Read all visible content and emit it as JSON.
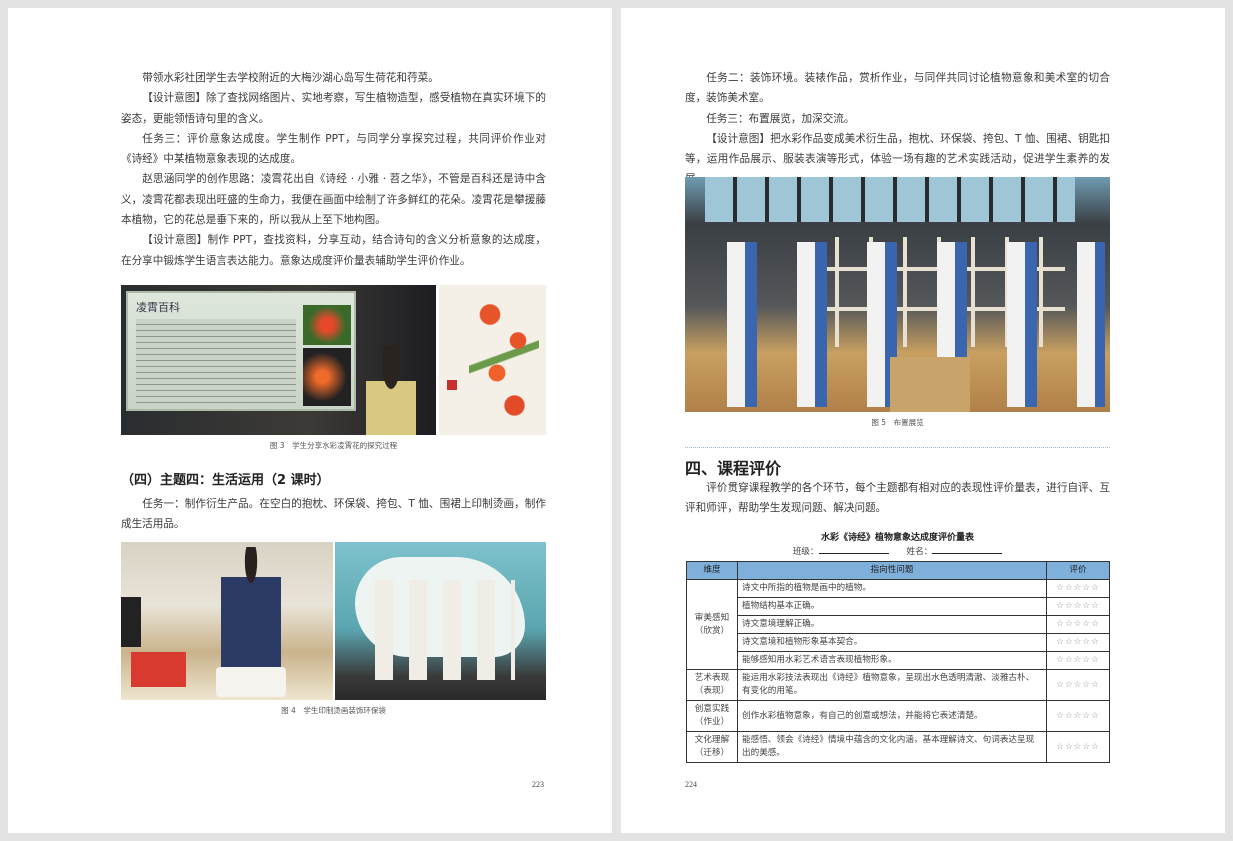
{
  "left_page": {
    "paragraphs": [
      "带领水彩社团学生去学校附近的大梅沙湖心岛写生荷花和荇菜。",
      "【设计意图】除了查找网络图片、实地考察，写生植物造型，感受植物在真实环境下的姿态，更能领悟诗句里的含义。",
      "任务三：评价意象达成度。学生制作 PPT，与同学分享探究过程，共同评价作业对《诗经》中某植物意象表现的达成度。",
      "赵思涵同学的创作思路：凌霄花出自《诗经 · 小雅 · 苕之华》，不管是百科还是诗中含义，凌霄花都表现出旺盛的生命力，我便在画面中绘制了许多鲜红的花朵。凌霄花是攀援藤本植物，它的花总是垂下来的，所以我从上至下地构图。",
      "【设计意图】制作 PPT，查找资料，分享互动，结合诗句的含义分析意象的达成度，在分享中锻炼学生语言表达能力。意象达成度评价量表辅助学生评价作业。"
    ],
    "slide_title": "凌霄百科",
    "figure3_caption": "图 3　学生分享水彩凌霄花的探究过程",
    "section_heading": "（四）主题四：生活运用（2 课时）",
    "task1": "任务一：制作衍生产品。在空白的抱枕、环保袋、挎包、T 恤、围裙上印制烫画，制作成生活用品。",
    "figure4_caption": "图 4　学生印制烫画装饰环保袋",
    "page_number": "223"
  },
  "right_page": {
    "paragraphs": [
      "任务二：装饰环境。装裱作品，赏析作业，与同伴共同讨论植物意象和美术室的切合度，装饰美术室。",
      "任务三：布置展览，加深交流。",
      "【设计意图】把水彩作品变成美术衍生品，抱枕、环保袋、挎包、T 恤、围裙、钥匙扣等，运用作品展示、服装表演等形式，体验一场有趣的艺术实践活动，促进学生素养的发展。"
    ],
    "figure5_caption": "图 5　布置展览",
    "section_heading": "四、课程评价",
    "intro": "评价贯穿课程教学的各个环节，每个主题都有相对应的表现性评价量表，进行自评、互评和师评，帮助学生发现问题、解决问题。",
    "table": {
      "title": "水彩《诗经》植物意象达成度评价量表",
      "class_label": "班级：",
      "name_label": "姓名：",
      "headers": [
        "维度",
        "指向性问题",
        "评价"
      ],
      "stars": "☆☆☆☆☆",
      "groups": [
        {
          "dimension": "审美感知\n（欣赏）",
          "items": [
            "诗文中所指的植物是画中的植物。",
            "植物结构基本正确。",
            "诗文意境理解正确。",
            "诗文意境和植物形象基本契合。",
            "能够感知用水彩艺术语言表现植物形象。"
          ]
        },
        {
          "dimension": "艺术表现\n（表现）",
          "items": [
            "能运用水彩技法表现出《诗经》植物意象，呈现出水色透明清澈、淡雅古朴、有变化的用笔。"
          ]
        },
        {
          "dimension": "创意实践\n（作业）",
          "items": [
            "创作水彩植物意象，有自己的创意或想法，并能将它表述清楚。"
          ]
        },
        {
          "dimension": "文化理解\n（迁移）",
          "items": [
            "能感悟、领会《诗经》情境中蕴含的文化内涵，基本理解诗文、句词表达呈现出的美感。"
          ]
        }
      ]
    },
    "page_number": "224"
  }
}
